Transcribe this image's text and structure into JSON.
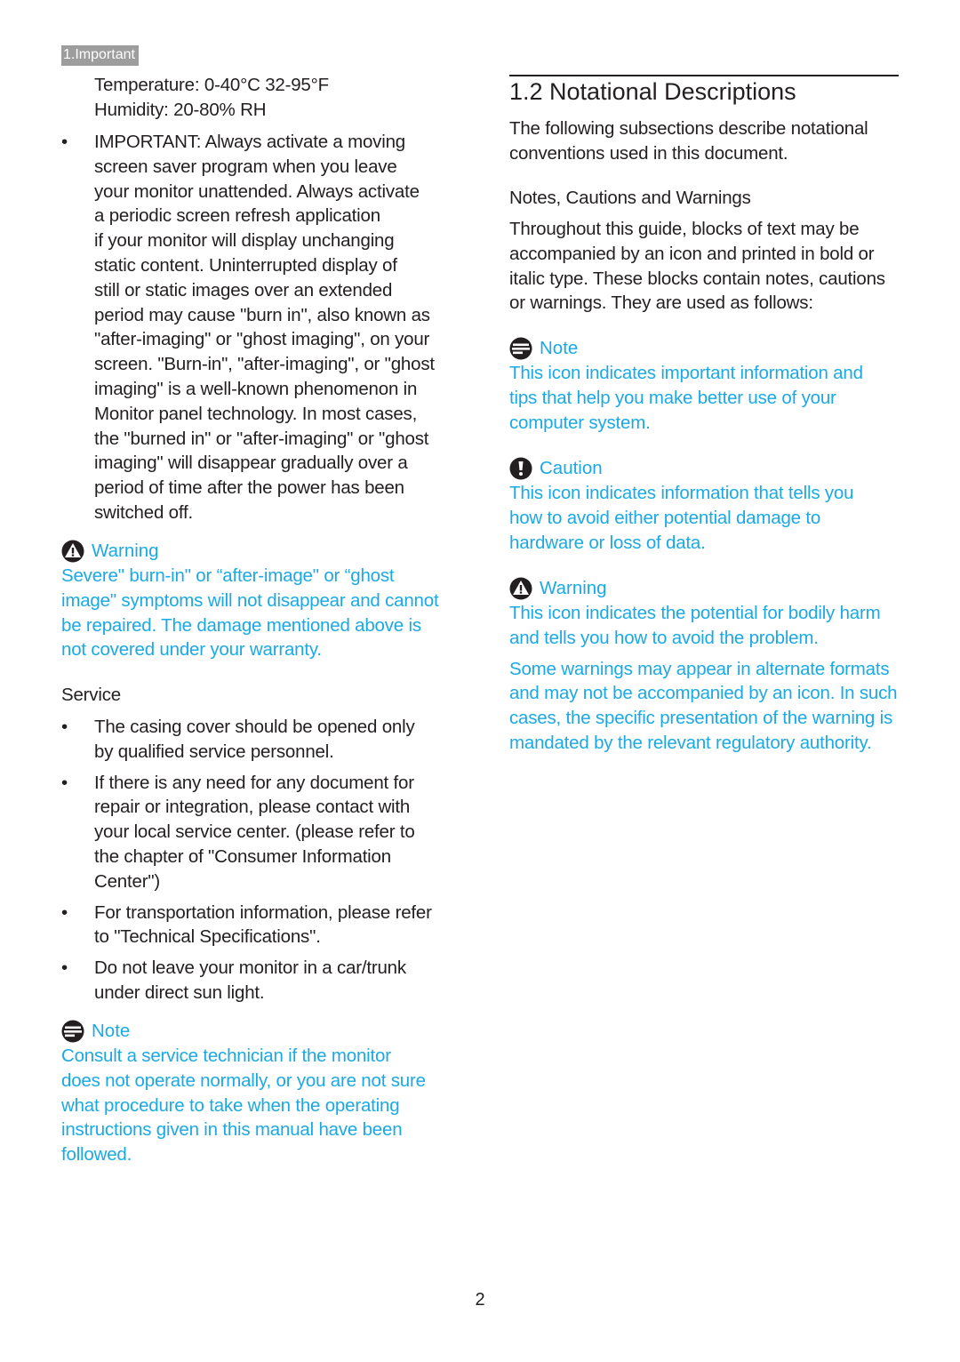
{
  "section_tag": "1.Important",
  "left": {
    "env": {
      "temperature": "Temperature: 0-40°C 32-95°F",
      "humidity": "Humidity: 20-80% RH"
    },
    "important_bullet": [
      "IMPORTANT: Always activate a moving",
      "screen saver program when you leave",
      "your monitor unattended. Always activate",
      "a periodic screen refresh application",
      "if your monitor will display unchanging",
      "static content. Uninterrupted display of",
      "still or static images over an extended",
      "period may cause \"burn in\", also known as",
      "\"after-imaging\" or \"ghost imaging\", on your",
      "screen. \"Burn-in\", \"after-imaging\", or \"ghost",
      "imaging\" is a well-known phenomenon in",
      "Monitor panel technology. In most cases,",
      "the \"burned in\" or \"after-imaging\" or \"ghost",
      "imaging\" will disappear gradually over a",
      "period of time after the power has been",
      "switched off."
    ],
    "warning": {
      "title": "Warning",
      "lines": [
        "Severe\" burn-in\" or “after-image\" or “ghost",
        "image\" symptoms will not disappear and cannot",
        "be repaired. The damage mentioned above is",
        "not covered under your warranty."
      ]
    },
    "service": {
      "title": "Service",
      "bullets": [
        [
          "The casing cover should be opened only",
          "by qualified service personnel."
        ],
        [
          "If there is any need for any document for",
          "repair or integration, please contact with",
          "your local service center. (please refer to",
          "the chapter of \"Consumer Information",
          "Center\")"
        ],
        [
          "For transportation information, please refer",
          "to \"Technical Specifications\"."
        ],
        [
          "Do not leave your monitor in a car/trunk",
          "under direct sun light."
        ]
      ]
    },
    "note": {
      "title": "Note",
      "lines": [
        "Consult a service technician if the monitor",
        "does not operate normally, or you are not sure",
        "what procedure to take when the operating",
        "instructions given in this manual have been",
        "followed."
      ]
    }
  },
  "right": {
    "heading": "1.2  Notational Descriptions",
    "intro": [
      "The following subsections describe notational",
      "conventions used in this document."
    ],
    "subheading": "Notes, Cautions and Warnings",
    "body": [
      "Throughout this guide, blocks of text may be",
      "accompanied by an icon and printed in bold or",
      "italic type. These blocks contain notes, cautions",
      "or warnings. They are used as follows:"
    ],
    "note": {
      "title": "Note",
      "lines": [
        "This icon indicates important information and",
        "tips that help you make better use of your",
        "computer system."
      ]
    },
    "caution": {
      "title": "Caution",
      "lines": [
        "This icon indicates information that tells you",
        "how to avoid either potential damage to",
        "hardware or loss of data."
      ]
    },
    "warning": {
      "title": "Warning",
      "lines": [
        "This icon indicates the potential for bodily harm",
        "and tells you how to avoid the problem."
      ],
      "extra": [
        "Some warnings may appear in alternate formats",
        "and may not be accompanied by an icon. In such",
        "cases, the specific presentation of the warning is",
        "mandated by the relevant regulatory authority."
      ]
    }
  },
  "page_number": "2",
  "colors": {
    "accent_blue": "#1ba9e6",
    "text": "#231f20",
    "tag_bg": "#9d9d9d"
  }
}
